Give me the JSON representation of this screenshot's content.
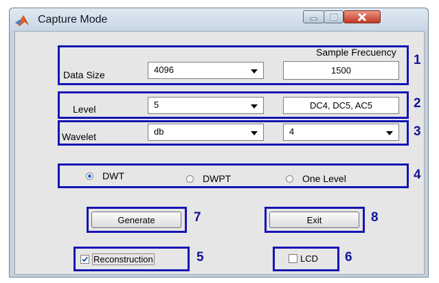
{
  "window": {
    "title": "Capture Mode",
    "app_icon": "matlab-logo-icon",
    "controls": [
      "minimize-icon",
      "maximize-icon",
      "close-icon"
    ]
  },
  "panel1": {
    "number": "1",
    "data_size_label": "Data Size",
    "data_size_value": "4096",
    "sample_frequency_label": "Sample Frecuency",
    "sample_frequency_value": "1500"
  },
  "panel2": {
    "number": "2",
    "level_label": "Level",
    "level_value": "5",
    "coefficients_value": "DC4, DC5, AC5"
  },
  "panel3": {
    "number": "3",
    "wavelet_label": "Wavelet",
    "wavelet_family": "db",
    "wavelet_order": "4"
  },
  "panel4": {
    "number": "4",
    "options": [
      "DWT",
      "DWPT",
      "One Level"
    ],
    "selected": "DWT"
  },
  "generate": {
    "label": "Generate",
    "number": "7"
  },
  "exit": {
    "label": "Exit",
    "number": "8"
  },
  "reconstruction": {
    "label": "Reconstruction",
    "checked": true,
    "number": "5"
  },
  "lcd": {
    "label": "LCD",
    "checked": false,
    "number": "6"
  },
  "colors": {
    "annotation_blue": "#1414b4",
    "window_frame": "#c6d3df",
    "client_bg": "#e6e6e6",
    "close_red": "#c23a22"
  }
}
